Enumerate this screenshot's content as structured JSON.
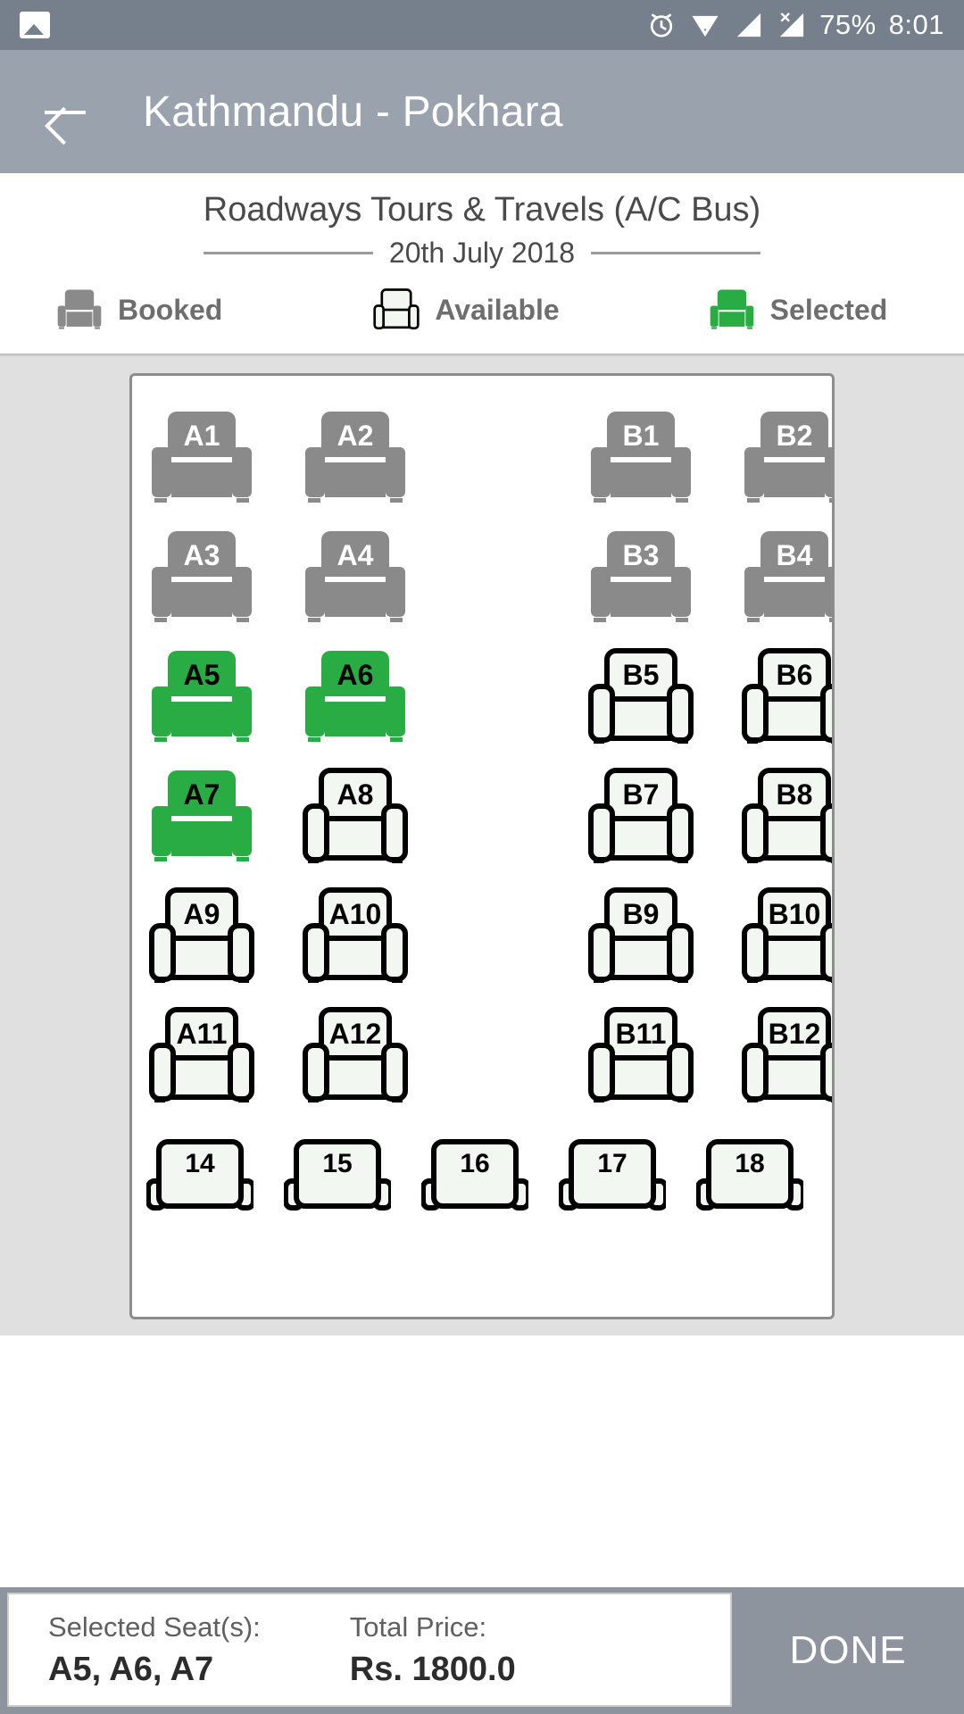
{
  "statusbar": {
    "battery": "75%",
    "time": "8:01",
    "icons": [
      "image-icon",
      "alarm-icon",
      "wifi-icon",
      "signal-icon",
      "signal-no-sim-icon"
    ]
  },
  "appbar": {
    "back_icon": "back-arrow-icon",
    "title": "Kathmandu - Pokhara"
  },
  "info": {
    "bus_name": "Roadways Tours & Travels (A/C Bus)",
    "date": "20th July 2018"
  },
  "legend": [
    {
      "key": "booked",
      "label": "Booked",
      "color": "#8a8a8a"
    },
    {
      "key": "available",
      "label": "Available",
      "color": "#f2f7f2"
    },
    {
      "key": "selected",
      "label": "Selected",
      "color": "#2aac44"
    }
  ],
  "colors": {
    "booked": "#8a8a8a",
    "available_fill": "#f2f7f2",
    "available_stroke": "#000000",
    "selected": "#2aac44",
    "statusbar": "#76808c",
    "appbar": "#9aa2ae",
    "stage": "#e0e0e0",
    "footer": "#8d949e"
  },
  "seatmap": {
    "rows": [
      {
        "left": [
          {
            "label": "A1",
            "state": "booked"
          },
          {
            "label": "A2",
            "state": "booked"
          }
        ],
        "right": [
          {
            "label": "B1",
            "state": "booked"
          },
          {
            "label": "B2",
            "state": "booked"
          }
        ]
      },
      {
        "left": [
          {
            "label": "A3",
            "state": "booked"
          },
          {
            "label": "A4",
            "state": "booked"
          }
        ],
        "right": [
          {
            "label": "B3",
            "state": "booked"
          },
          {
            "label": "B4",
            "state": "booked"
          }
        ]
      },
      {
        "left": [
          {
            "label": "A5",
            "state": "selected"
          },
          {
            "label": "A6",
            "state": "selected"
          }
        ],
        "right": [
          {
            "label": "B5",
            "state": "available"
          },
          {
            "label": "B6",
            "state": "available"
          }
        ]
      },
      {
        "left": [
          {
            "label": "A7",
            "state": "selected"
          },
          {
            "label": "A8",
            "state": "available"
          }
        ],
        "right": [
          {
            "label": "B7",
            "state": "available"
          },
          {
            "label": "B8",
            "state": "available"
          }
        ]
      },
      {
        "left": [
          {
            "label": "A9",
            "state": "available"
          },
          {
            "label": "A10",
            "state": "available"
          }
        ],
        "right": [
          {
            "label": "B9",
            "state": "available"
          },
          {
            "label": "B10",
            "state": "available"
          }
        ]
      },
      {
        "left": [
          {
            "label": "A11",
            "state": "available"
          },
          {
            "label": "A12",
            "state": "available"
          }
        ],
        "right": [
          {
            "label": "B11",
            "state": "available"
          },
          {
            "label": "B12",
            "state": "available"
          }
        ]
      }
    ],
    "back_row": [
      {
        "label": "14",
        "state": "available"
      },
      {
        "label": "15",
        "state": "available"
      },
      {
        "label": "16",
        "state": "available"
      },
      {
        "label": "17",
        "state": "available"
      },
      {
        "label": "18",
        "state": "available"
      }
    ]
  },
  "footer": {
    "seats_label": "Selected Seat(s):",
    "seats_value": "A5, A6, A7",
    "price_label": "Total Price:",
    "price_value": "Rs. 1800.0",
    "done_label": "DONE"
  }
}
